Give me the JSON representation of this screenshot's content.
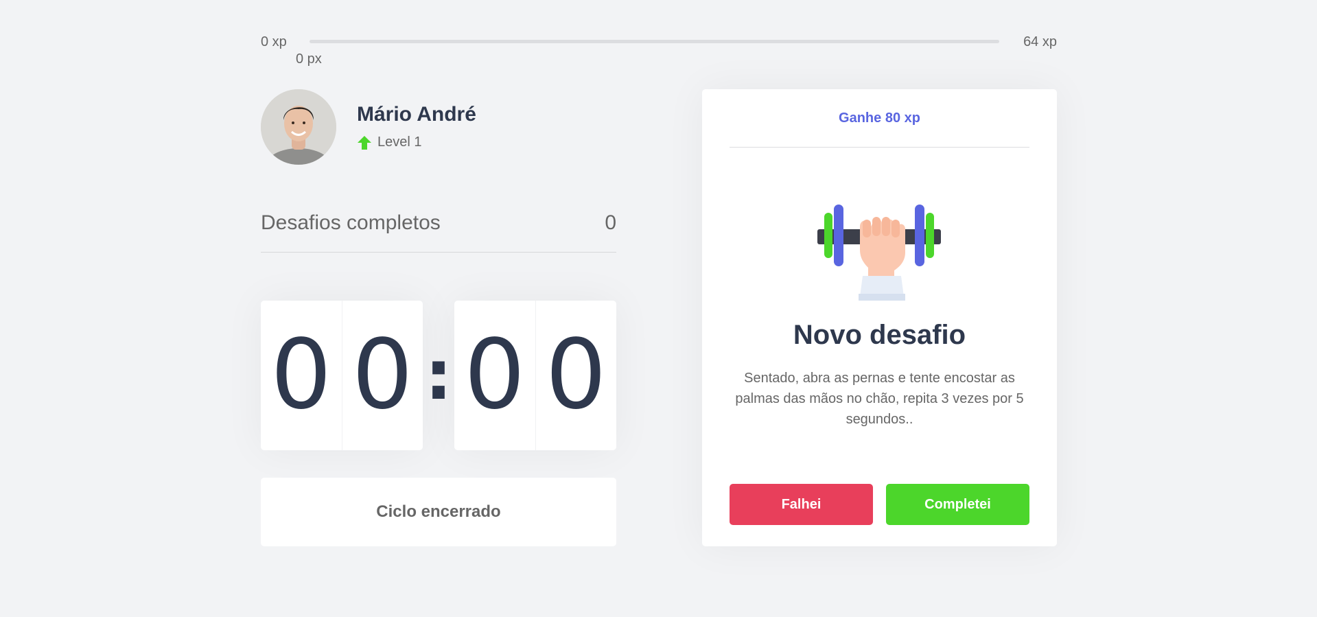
{
  "xp_bar": {
    "min_label": "0 xp",
    "max_label": "64 xp",
    "current_label": "0 px",
    "progress_percent": 0,
    "fill_color": "#4cd62b"
  },
  "profile": {
    "name": "Mário André",
    "level_label": "Level 1",
    "level_icon": "level-up-arrow-icon"
  },
  "completed": {
    "label": "Desafios completos",
    "count": "0"
  },
  "countdown": {
    "minute_left": "0",
    "minute_right": "0",
    "separator": ":",
    "second_left": "0",
    "second_right": "0"
  },
  "cycle_button": {
    "label": "Ciclo encerrado"
  },
  "challenge": {
    "header": "Ganhe 80 xp",
    "icon": "dumbbell-body-icon",
    "title": "Novo desafio",
    "description": "Sentado, abra as pernas e tente encostar as palmas das mãos no chão, repita 3 vezes por 5 segundos..",
    "fail_label": "Falhei",
    "complete_label": "Completei"
  },
  "colors": {
    "background": "#f2f3f5",
    "text": "#666666",
    "title": "#2e384d",
    "blue": "#5965e0",
    "red": "#e83f5b",
    "green": "#4cd62b"
  }
}
